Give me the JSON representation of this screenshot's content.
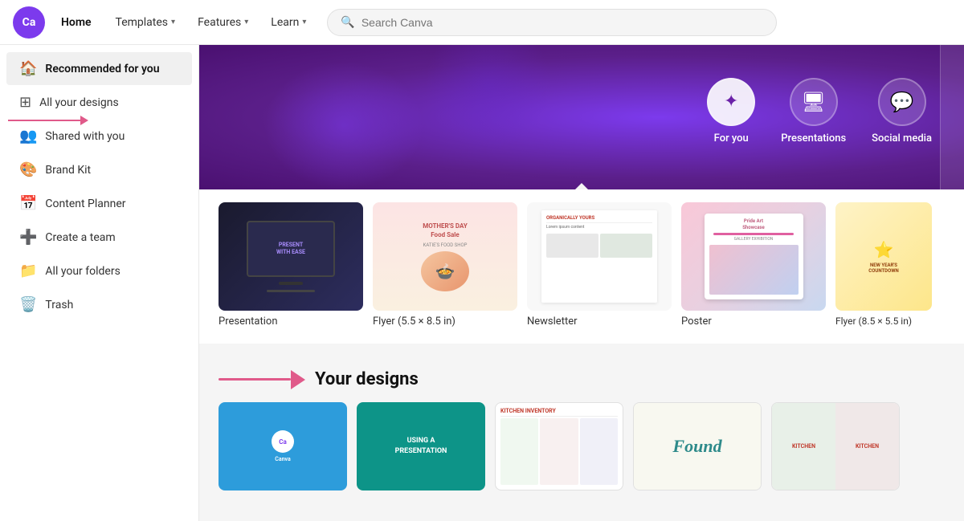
{
  "header": {
    "logo_text": "Ca",
    "home_label": "Home",
    "nav_items": [
      {
        "label": "Templates",
        "id": "templates"
      },
      {
        "label": "Features",
        "id": "features"
      },
      {
        "label": "Learn",
        "id": "learn"
      }
    ],
    "search_placeholder": "Search Canva"
  },
  "sidebar": {
    "items": [
      {
        "id": "recommended",
        "label": "Recommended for you",
        "icon": "🏠",
        "active": true
      },
      {
        "id": "all-designs",
        "label": "All your designs",
        "icon": "⊞",
        "active": false
      },
      {
        "id": "shared",
        "label": "Shared with you",
        "icon": "👥",
        "active": false
      },
      {
        "id": "brand-kit",
        "label": "Brand Kit",
        "icon": "🎨",
        "active": false
      },
      {
        "id": "content-planner",
        "label": "Content Planner",
        "icon": "📅",
        "active": false
      },
      {
        "id": "create-team",
        "label": "Create a team",
        "icon": "➕",
        "active": false
      },
      {
        "id": "all-folders",
        "label": "All your folders",
        "icon": "📁",
        "active": false
      },
      {
        "id": "trash",
        "label": "Trash",
        "icon": "🗑️",
        "active": false
      }
    ]
  },
  "banner": {
    "icons": [
      {
        "id": "for-you",
        "label": "For you",
        "symbol": "✦",
        "active": true
      },
      {
        "id": "presentations",
        "label": "Presentations",
        "symbol": "🖥",
        "active": false
      },
      {
        "id": "social-media",
        "label": "Social media",
        "symbol": "💬",
        "active": false
      }
    ]
  },
  "templates": {
    "items": [
      {
        "id": "presentation",
        "label": "Presentation",
        "type": "presentation"
      },
      {
        "id": "flyer-5.5",
        "label": "Flyer (5.5 × 8.5 in)",
        "type": "flyer"
      },
      {
        "id": "newsletter",
        "label": "Newsletter",
        "type": "newsletter"
      },
      {
        "id": "poster",
        "label": "Poster",
        "type": "poster"
      },
      {
        "id": "flyer-8.5",
        "label": "Flyer (8.5 × 5.5 in)",
        "type": "flyer2"
      }
    ]
  },
  "designs_section": {
    "title": "Your designs",
    "arrow_symbol": "▶"
  },
  "annotations": {
    "sidebar_arrow_label": "All your designs arrow annotation"
  }
}
